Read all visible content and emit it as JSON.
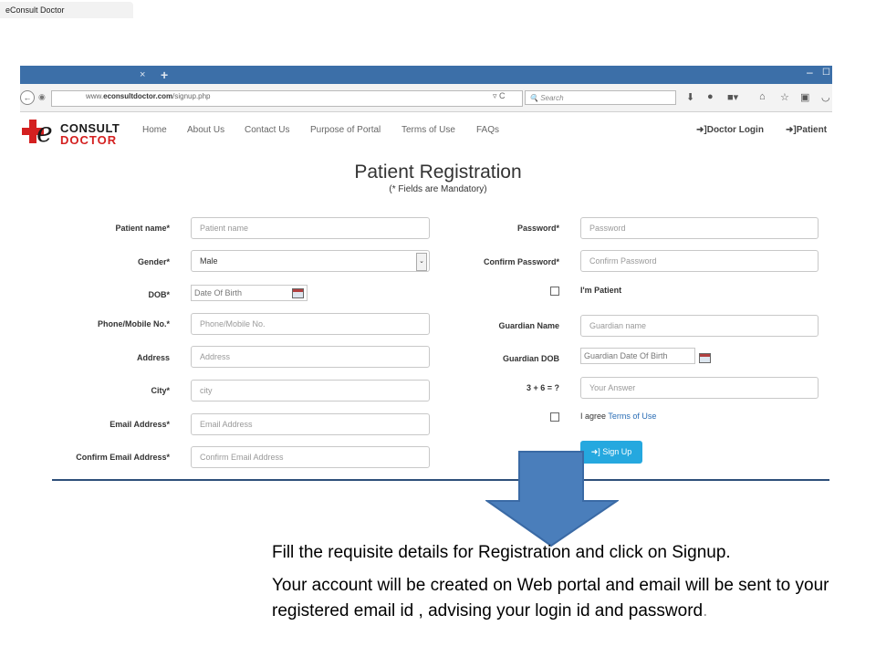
{
  "browser": {
    "tab_title": "eConsult Doctor",
    "tab_close": "×",
    "new_tab": "+",
    "url_prefix": "www.",
    "url_domain": "econsultdoctor.com",
    "url_path": "/signup.php",
    "search_placeholder": "Search"
  },
  "site": {
    "logo_top": "CONSULT",
    "logo_bottom": "DOCTOR",
    "logo_letter": "e",
    "nav": [
      "Home",
      "About Us",
      "Contact Us",
      "Purpose of Portal",
      "Terms of Use",
      "FAQs"
    ],
    "doctor_login": "Doctor Login",
    "patient_login": "Patient"
  },
  "form": {
    "title": "Patient Registration",
    "subtitle": "(* Fields are Mandatory)",
    "left": {
      "patient_name": {
        "label": "Patient name*",
        "placeholder": "Patient name"
      },
      "gender": {
        "label": "Gender*",
        "value": "Male"
      },
      "dob": {
        "label": "DOB*",
        "placeholder": "Date Of Birth"
      },
      "phone": {
        "label": "Phone/Mobile No.*",
        "placeholder": "Phone/Mobile No."
      },
      "address": {
        "label": "Address",
        "placeholder": "Address"
      },
      "city": {
        "label": "City*",
        "placeholder": "city"
      },
      "email": {
        "label": "Email Address*",
        "placeholder": "Email Address"
      },
      "confirm_email": {
        "label": "Confirm Email Address*",
        "placeholder": "Confirm Email Address"
      }
    },
    "right": {
      "password": {
        "label": "Password*",
        "placeholder": "Password"
      },
      "confirm_password": {
        "label": "Confirm Password*",
        "placeholder": "Confirm Password"
      },
      "im_patient": "I'm Patient",
      "guardian_name": {
        "label": "Guardian Name",
        "placeholder": "Guardian name"
      },
      "guardian_dob": {
        "label": "Guardian DOB",
        "placeholder": "Guardian Date Of Birth"
      },
      "captcha": {
        "label": "3 + 6 = ?",
        "placeholder": "Your Answer"
      },
      "agree_prefix": "I agree ",
      "agree_link": "Terms of Use",
      "signup": "Sign Up"
    }
  },
  "instructions": {
    "line1": "Fill the requisite details for Registration  and click on Signup.",
    "line2": "Your account will be created on Web portal  and email will be sent to your registered email id , advising your  login id and password",
    "line2_end": "."
  },
  "colors": {
    "tabbar": "#3c6fa8",
    "brand_red": "#d42020",
    "signup_button": "#25a8df",
    "arrow_fill": "#4a7ebb",
    "divider": "#2e4f7a"
  }
}
